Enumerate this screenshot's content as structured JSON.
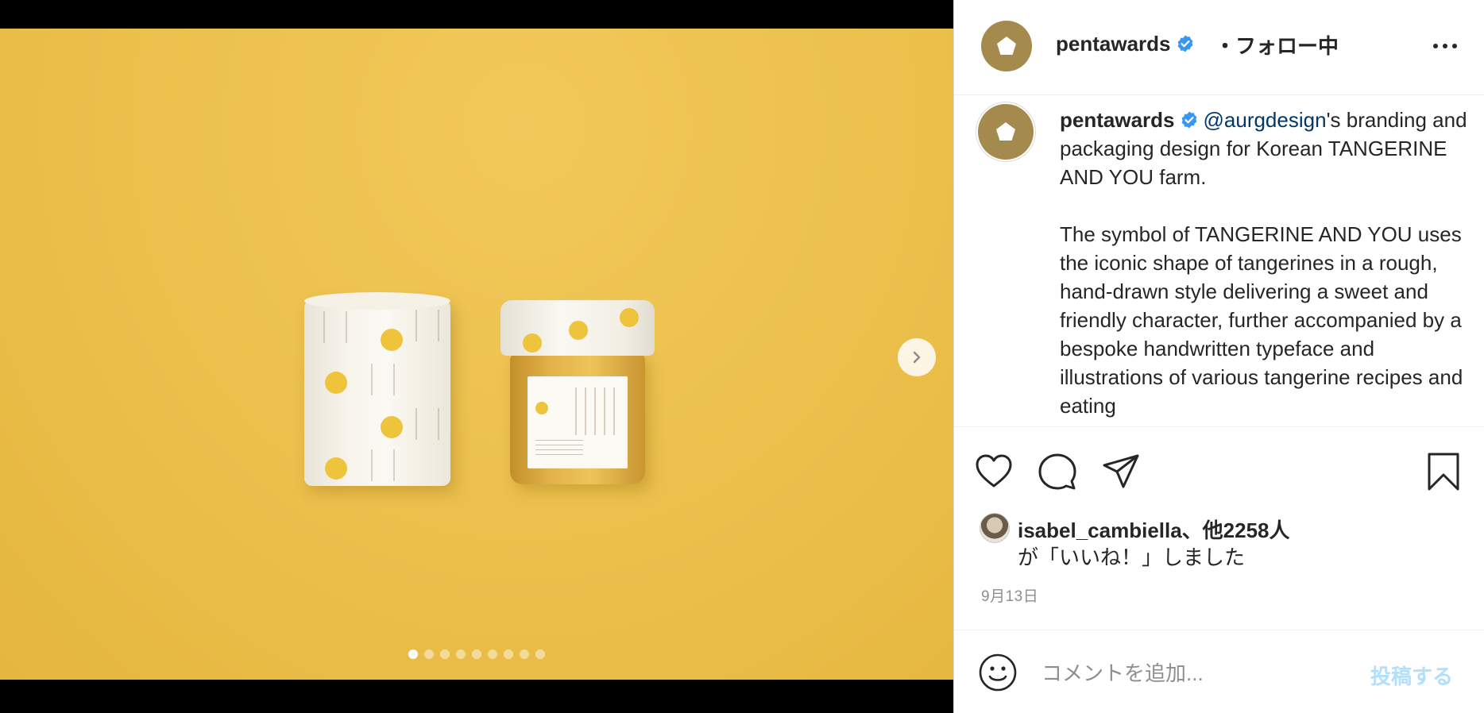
{
  "header": {
    "username": "pentawards",
    "separator": "・",
    "follow_status": "フォロー中",
    "more_label": "…"
  },
  "caption": {
    "username": "pentawards",
    "mention": "@aurgdesign",
    "text_after_mention": "'s branding and packaging design for Korean TANGERINE AND YOU farm.\n\nThe symbol of TANGERINE AND YOU uses the iconic shape of tangerines in a rough, hand-drawn style delivering a sweet and friendly character, further accompanied by a bespoke handwritten typeface and illustrations of various tangerine recipes and eating"
  },
  "likes": {
    "user": "isabel_cambiella、他2258人",
    "suffix": "が「いいね！」しました"
  },
  "date": "9月13日",
  "comment": {
    "placeholder": "コメントを追加...",
    "post_label": "投稿する"
  },
  "carousel": {
    "total_slides": 9,
    "current_slide": 1
  },
  "icons": {
    "avatar": "pentagon-logo-icon",
    "verified": "verified-badge-icon",
    "like": "heart-icon",
    "comment": "comment-bubble-icon",
    "share": "paper-plane-icon",
    "save": "bookmark-icon",
    "emoji": "smiley-icon",
    "next": "chevron-right-icon"
  },
  "colors": {
    "verified_blue": "#3897f0",
    "mention": "#00376b",
    "post_disabled": "#b2dffc",
    "avatar_gold": "#a48a4c",
    "photo_background": "#ecc14d"
  }
}
